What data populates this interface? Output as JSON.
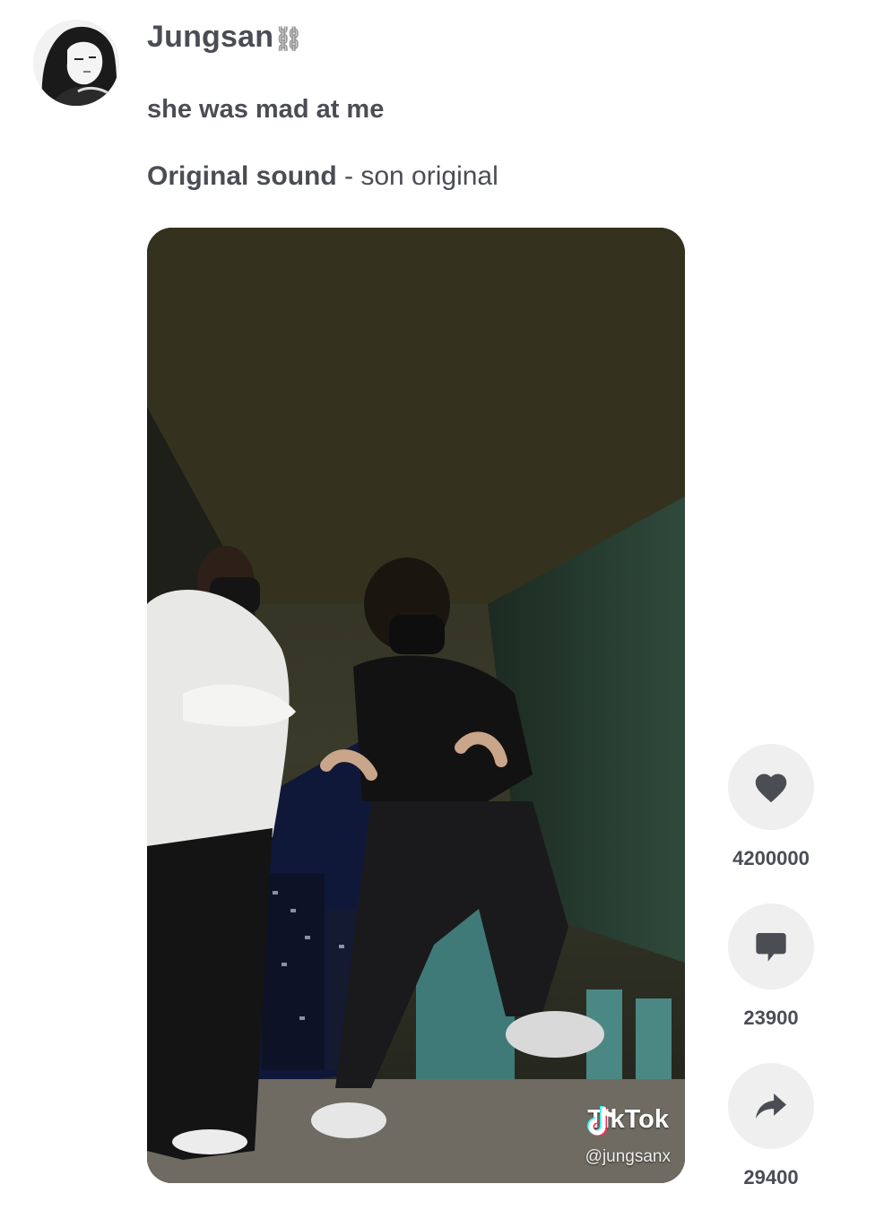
{
  "post": {
    "username": "Jungsan",
    "username_emoji": "⛓",
    "caption": "she was mad at me",
    "sound_title": "Original sound",
    "sound_separator": " - ",
    "sound_subtitle": "son original"
  },
  "video": {
    "watermark_brand": "TikTok",
    "watermark_handle": "@jungsanx"
  },
  "actions": {
    "like_count": "4200000",
    "comment_count": "23900",
    "share_count": "29400"
  },
  "icons": {
    "like": "heart-icon",
    "comment": "comment-icon",
    "share": "share-arrow-icon",
    "brand": "tiktok-note-icon"
  },
  "colors": {
    "text": "#4b4d55",
    "action_bg": "#efefef",
    "icon": "#4b4d55"
  }
}
